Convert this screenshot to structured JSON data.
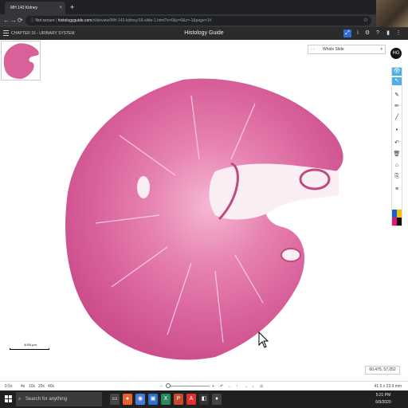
{
  "browser": {
    "tab_title": "MH 143 Kidney",
    "tab_close": "×",
    "new_tab": "+",
    "security": "Not secure",
    "host": "histologyguide.com",
    "path": "/slideview/MH-143-kidney/16-slide-1.html?x=0&y=0&z=-1&page=1#",
    "back": "←",
    "forward": "→",
    "reload": "⟳",
    "star": "☆"
  },
  "app": {
    "chapter": "CHAPTER 16 - URINARY SYSTEM",
    "title": "Histology Guide",
    "view_selector": {
      "value": "Whole Slide",
      "arrows": "‹ ›",
      "caret": "▾"
    },
    "logo": "HG"
  },
  "tools": {
    "items": [
      "👁",
      "↖",
      "✎",
      "✏",
      "╱",
      "•",
      "↶",
      "🗑",
      "⌂",
      "⎘",
      "≡"
    ],
    "active_index": [
      0,
      1
    ],
    "colors": [
      "#1a5fd0",
      "#f2c300",
      "#e01b6a",
      "#111111"
    ]
  },
  "viewer": {
    "scalebar_label": "4000 µm",
    "coords": "60,475, 57,052"
  },
  "bottombar": {
    "zoom_levels": [
      "0.5x",
      "4x",
      "10x",
      "20x",
      "40x"
    ],
    "minus": "−",
    "plus": "+",
    "nav": [
      "↶",
      "←",
      "↑",
      "→",
      "↓",
      "⊙"
    ],
    "dims": "41.5 x 23.9 mm"
  },
  "taskbar": {
    "search_placeholder": "Search for anything",
    "time": "5:21 PM",
    "date": "6/9/2020"
  }
}
